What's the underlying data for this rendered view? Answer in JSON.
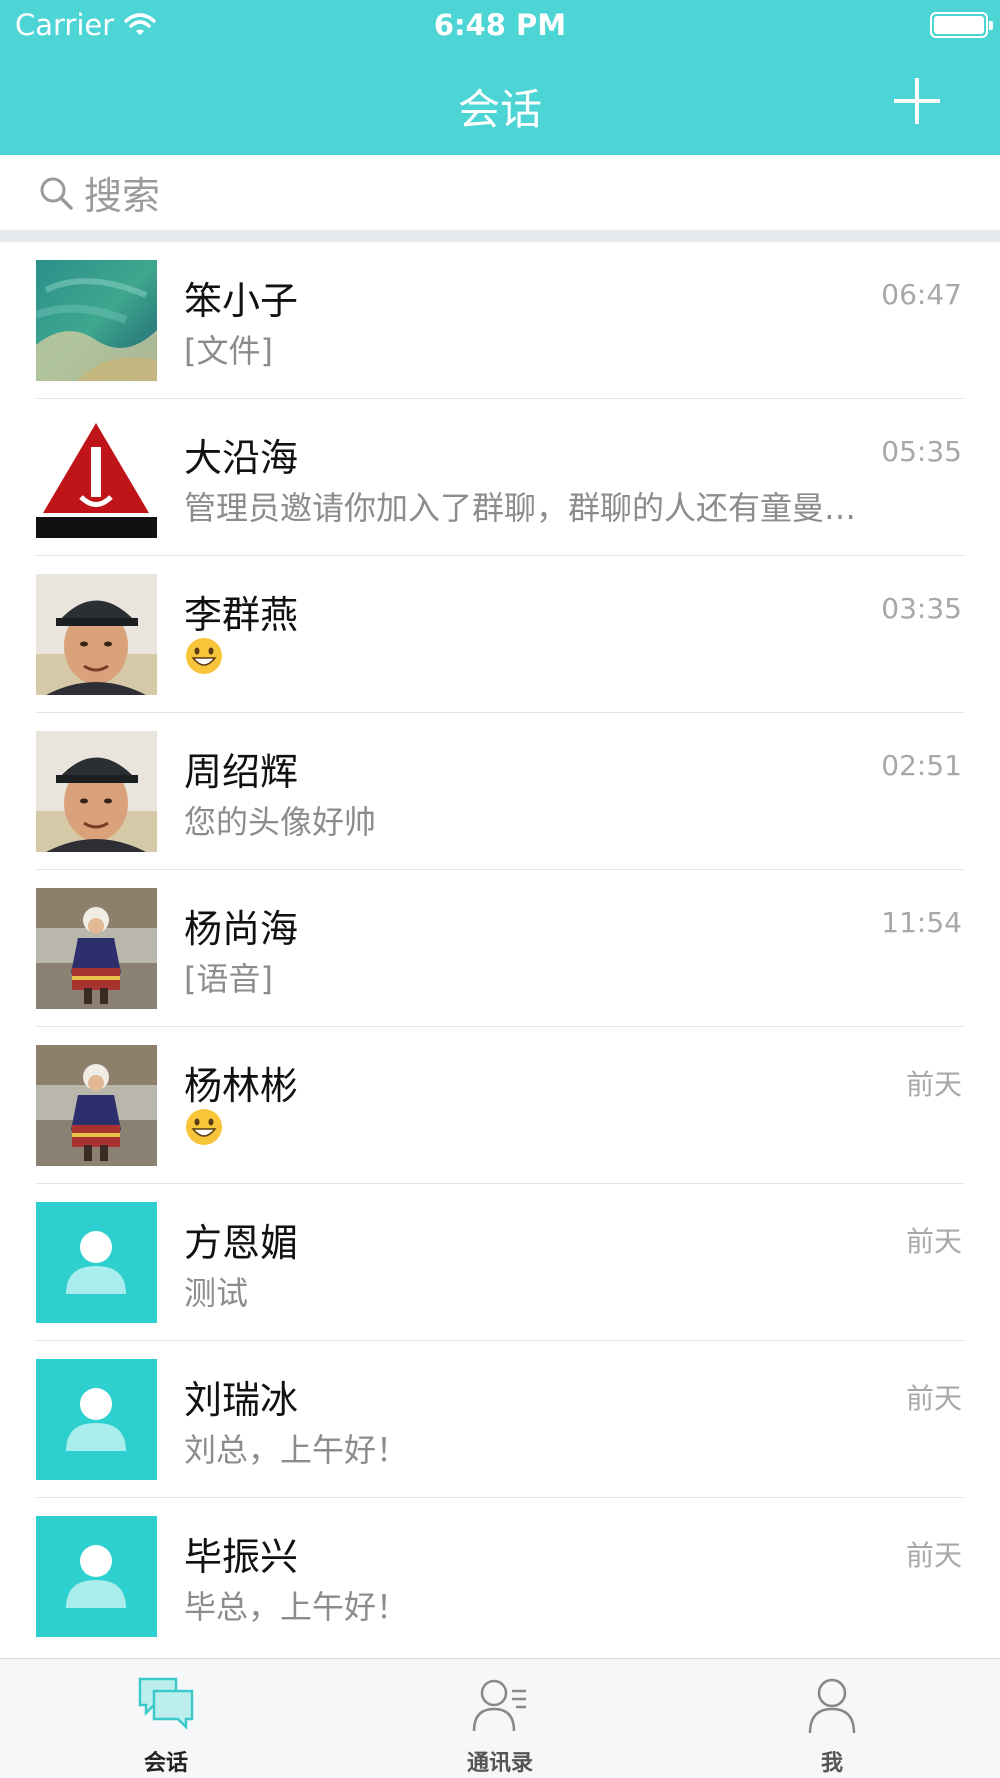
{
  "status_bar": {
    "carrier": "Carrier",
    "time": "6:48 PM"
  },
  "nav": {
    "title": "会话",
    "add_icon": "plus-icon"
  },
  "search": {
    "placeholder": "搜索"
  },
  "colors": {
    "accent": "#4dd4d4",
    "avatar_default": "#2ecfcf"
  },
  "conversations": [
    {
      "name": "笨小子",
      "message": "[文件]",
      "time": "06:47",
      "avatar": "ocean-photo"
    },
    {
      "name": "大沿海",
      "message": "管理员邀请你加入了群聊，群聊的人还有童曼…",
      "time": "05:35",
      "avatar": "red-triangle-logo"
    },
    {
      "name": "李群燕",
      "message": "",
      "time": "03:35",
      "avatar": "man-in-cap-photo",
      "emoji": "grinning-face"
    },
    {
      "name": "周绍辉",
      "message": "您的头像好帅",
      "time": "02:51",
      "avatar": "man-in-cap-photo"
    },
    {
      "name": "杨尚海",
      "message": "[语音]",
      "time": "11:54",
      "avatar": "child-costume-photo"
    },
    {
      "name": "杨林彬",
      "message": "",
      "time": "前天",
      "avatar": "child-costume-photo",
      "emoji": "grinning-face"
    },
    {
      "name": "方恩媚",
      "message": "测试",
      "time": "前天",
      "avatar": "default-person"
    },
    {
      "name": "刘瑞冰",
      "message": "刘总，上午好！",
      "time": "前天",
      "avatar": "default-person"
    },
    {
      "name": "毕振兴",
      "message": "毕总，上午好！",
      "time": "前天",
      "avatar": "default-person"
    }
  ],
  "tabs": [
    {
      "label": "会话",
      "icon": "chat-bubbles-icon",
      "active": true
    },
    {
      "label": "通讯录",
      "icon": "contacts-icon",
      "active": false
    },
    {
      "label": "我",
      "icon": "person-icon",
      "active": false
    }
  ]
}
